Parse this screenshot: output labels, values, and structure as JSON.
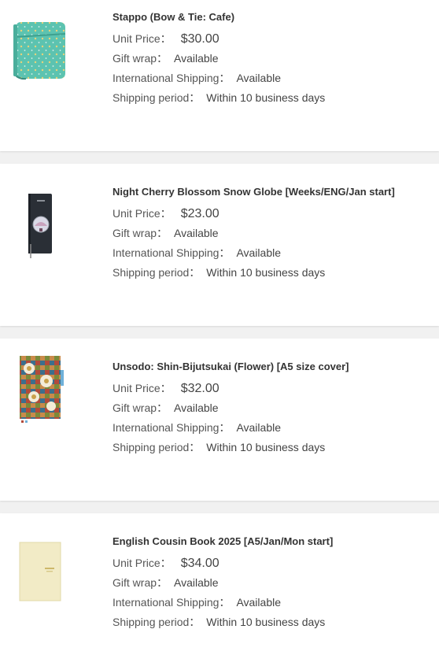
{
  "labels": {
    "unit_price": "Unit Price：",
    "gift_wrap": "Gift wrap：",
    "international_shipping": "International Shipping：",
    "shipping_period": "Shipping period："
  },
  "products": [
    {
      "name": "Stappo (Bow & Tie: Cafe)",
      "price": "$30.00",
      "gift_wrap": "Available",
      "international_shipping": "Available",
      "shipping_period": "Within 10 business days",
      "image_icon": "teal-pouch-image",
      "image_color": "#5cc3b0"
    },
    {
      "name": "Night Cherry Blossom Snow Globe [Weeks/ENG/Jan start]",
      "price": "$23.00",
      "gift_wrap": "Available",
      "international_shipping": "Available",
      "shipping_period": "Within 10 business days",
      "image_icon": "dark-planner-image",
      "image_color": "#2a2f36"
    },
    {
      "name": "Unsodo: Shin-Bijutsukai (Flower) [A5 size cover]",
      "price": "$32.00",
      "gift_wrap": "Available",
      "international_shipping": "Available",
      "shipping_period": "Within 10 business days",
      "image_icon": "patterned-cover-image",
      "image_color": "#8b5a3a"
    },
    {
      "name": "English Cousin Book 2025 [A5/Jan/Mon start]",
      "price": "$34.00",
      "gift_wrap": "Available",
      "international_shipping": "Available",
      "shipping_period": "Within 10 business days",
      "image_icon": "cream-book-image",
      "image_color": "#f2ebc6"
    }
  ]
}
